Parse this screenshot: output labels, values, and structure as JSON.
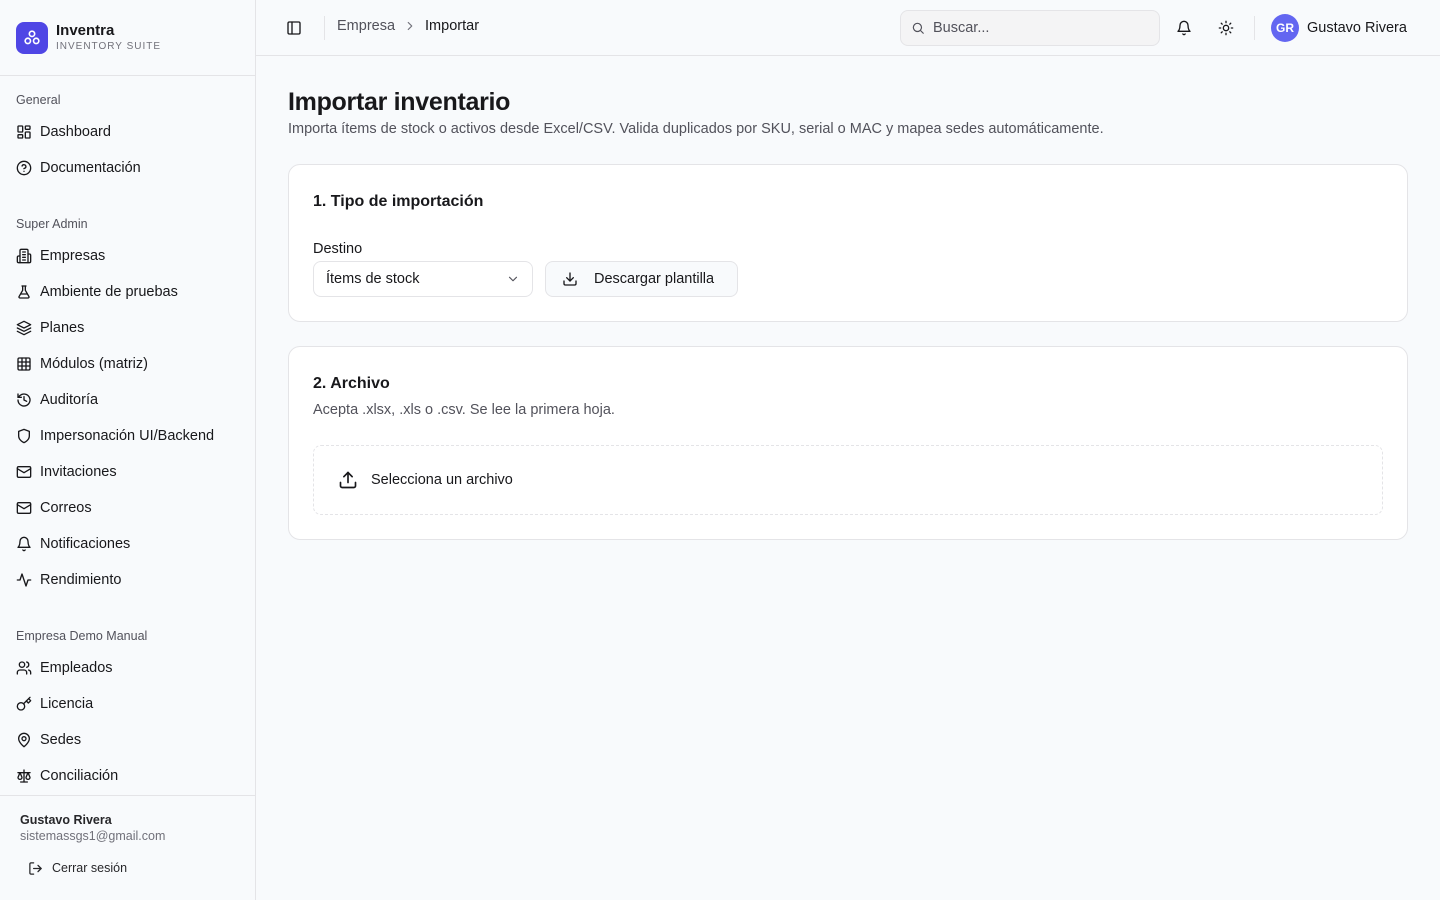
{
  "brand": {
    "name": "Inventra",
    "subtitle": "INVENTORY SUITE"
  },
  "sidebar": {
    "groups": [
      {
        "label": "General",
        "items": [
          {
            "label": "Dashboard",
            "icon": "dashboard-icon"
          },
          {
            "label": "Documentación",
            "icon": "help-circle-icon"
          }
        ]
      },
      {
        "label": "Super Admin",
        "items": [
          {
            "label": "Empresas",
            "icon": "building-icon"
          },
          {
            "label": "Ambiente de pruebas",
            "icon": "flask-icon"
          },
          {
            "label": "Planes",
            "icon": "layers-icon"
          },
          {
            "label": "Módulos (matriz)",
            "icon": "grid-icon"
          },
          {
            "label": "Auditoría",
            "icon": "history-icon"
          },
          {
            "label": "Impersonación UI/Backend",
            "icon": "shield-icon"
          },
          {
            "label": "Invitaciones",
            "icon": "mail-icon"
          },
          {
            "label": "Correos",
            "icon": "mail-icon"
          },
          {
            "label": "Notificaciones",
            "icon": "bell-icon"
          },
          {
            "label": "Rendimiento",
            "icon": "activity-icon"
          }
        ]
      },
      {
        "label": "Empresa Demo Manual",
        "items": [
          {
            "label": "Empleados",
            "icon": "users-icon"
          },
          {
            "label": "Licencia",
            "icon": "key-icon"
          },
          {
            "label": "Sedes",
            "icon": "map-pin-icon"
          },
          {
            "label": "Conciliación",
            "icon": "scale-icon"
          }
        ]
      }
    ],
    "footer": {
      "user_name": "Gustavo Rivera",
      "user_email": "sistemassgs1@gmail.com",
      "logout_label": "Cerrar sesión"
    }
  },
  "header": {
    "breadcrumb": {
      "parent": "Empresa",
      "current": "Importar"
    },
    "search_placeholder": "Buscar...",
    "user": {
      "initials": "GR",
      "name": "Gustavo Rivera"
    }
  },
  "main": {
    "title": "Importar inventario",
    "description": "Importa ítems de stock o activos desde Excel/CSV. Valida duplicados por SKU, serial o MAC y mapea sedes automáticamente.",
    "step1": {
      "title": "1. Tipo de importación",
      "field_label": "Destino",
      "selected_value": "Ítems de stock",
      "download_button": "Descargar plantilla"
    },
    "step2": {
      "title": "2. Archivo",
      "subtitle": "Acepta .xlsx, .xls o .csv. Se lee la primera hoja.",
      "dropzone_label": "Selecciona un archivo"
    }
  },
  "colors": {
    "accent": "#4f46e5",
    "avatar": "#6366f1",
    "border": "#e4e4e7",
    "background": "#f8fafc"
  }
}
